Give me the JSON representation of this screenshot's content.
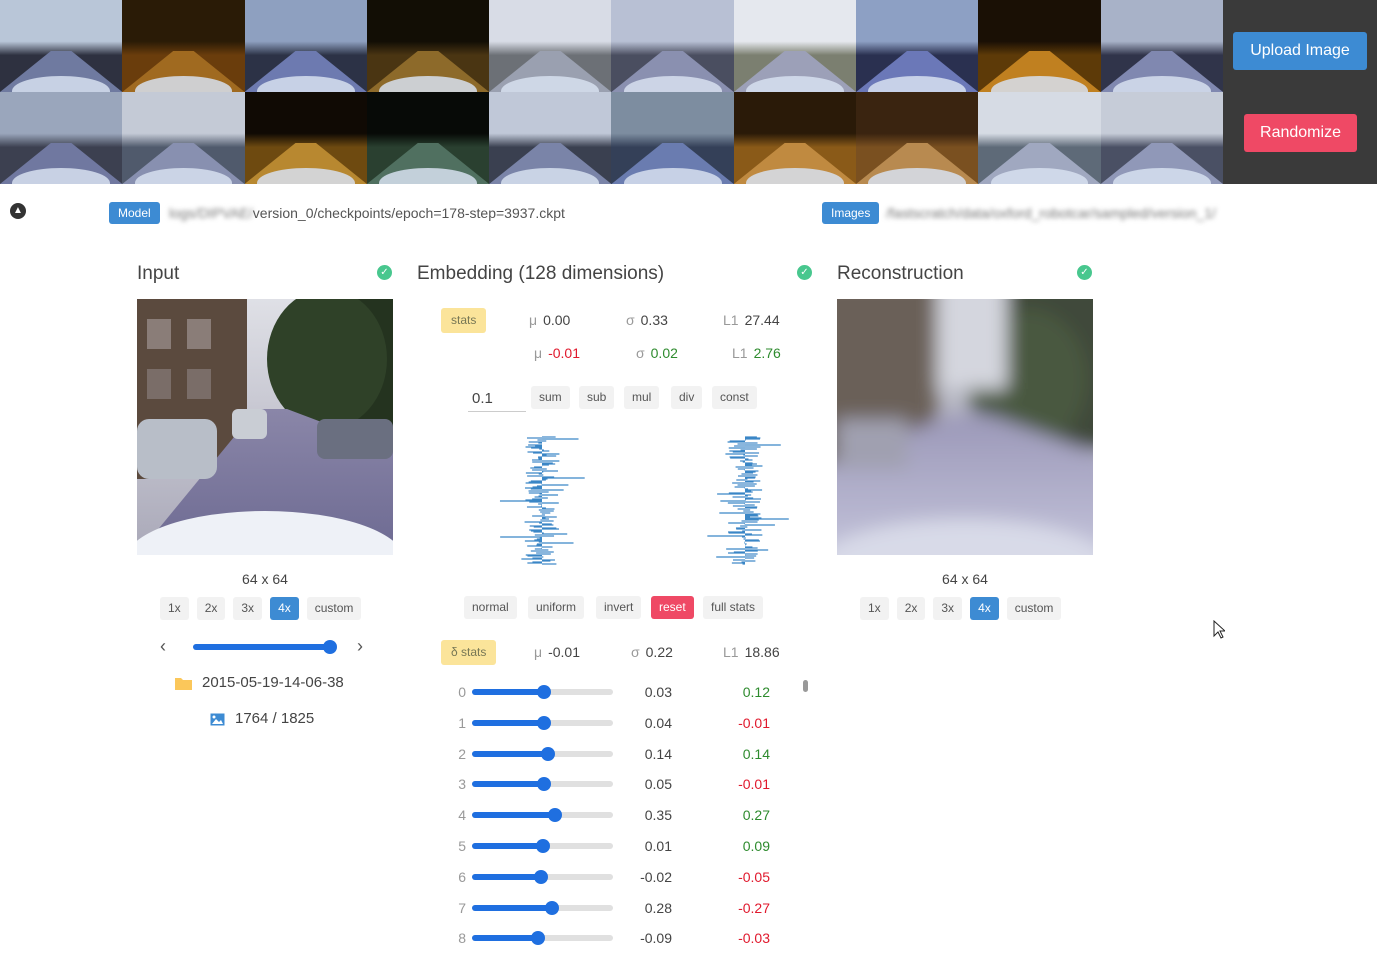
{
  "header": {
    "upload_label": "Upload Image",
    "randomize_label": "Randomize",
    "thumbnails": [
      {
        "sky": "#b9c6d8",
        "ground": "#2e3140",
        "road": "#6f7aa0"
      },
      {
        "sky": "#2a1b06",
        "ground": "#6a3d0c",
        "road": "#a06a20"
      },
      {
        "sky": "#8ea0c0",
        "ground": "#2c3246",
        "road": "#6d7ab0"
      },
      {
        "sky": "#120e05",
        "ground": "#4a3512",
        "road": "#8d6a2a"
      },
      {
        "sky": "#d8dce6",
        "ground": "#6c7076",
        "road": "#9aa0b0"
      },
      {
        "sky": "#b8c0d4",
        "ground": "#4a4e60",
        "road": "#8a90b0"
      },
      {
        "sky": "#e5e8ee",
        "ground": "#7b7f70",
        "road": "#9ca0b8"
      },
      {
        "sky": "#8da0c4",
        "ground": "#2a3050",
        "road": "#6b78b8"
      },
      {
        "sky": "#1a1005",
        "ground": "#5d3a08",
        "road": "#c08020"
      },
      {
        "sky": "#a8b2c8",
        "ground": "#30344a",
        "road": "#8088b0"
      },
      {
        "sky": "#9aa6bc",
        "ground": "#3c4050",
        "road": "#7078a0"
      },
      {
        "sky": "#c4cad6",
        "ground": "#505a6c",
        "road": "#8890b0"
      },
      {
        "sky": "#100a04",
        "ground": "#6e4a10",
        "road": "#b88830"
      },
      {
        "sky": "#070a07",
        "ground": "#2a4030",
        "road": "#507060"
      },
      {
        "sky": "#c0c8d8",
        "ground": "#3a4050",
        "road": "#7a84a8"
      },
      {
        "sky": "#7d8da0",
        "ground": "#344058",
        "road": "#6a7cb0"
      },
      {
        "sky": "#2a1a08",
        "ground": "#8a5a18",
        "road": "#c08a40"
      },
      {
        "sky": "#3a2410",
        "ground": "#7a5020",
        "road": "#b88a50"
      },
      {
        "sky": "#d6dbe4",
        "ground": "#5e6a78",
        "road": "#a0a8c0"
      },
      {
        "sky": "#c6ccd8",
        "ground": "#4a5064",
        "road": "#9098b8"
      }
    ]
  },
  "toolbar": {
    "model_tag": "Model",
    "model_path": "logs/DIPVAE/version_0/checkpoints/epoch=178-step=3937.ckpt",
    "model_path_blurred": "logs/DIPVAE/",
    "model_path_visible": "version_0/checkpoints/epoch=178-step=3937.ckpt",
    "images_tag": "Images",
    "images_path": "/fastscratch/data/oxford_robotcar/sampled/version_1/"
  },
  "input": {
    "title": "Input",
    "size_label": "64 x 64",
    "zoom_options": [
      "1x",
      "2x",
      "3x",
      "4x",
      "custom"
    ],
    "zoom_selected": "4x",
    "frame_position": 0.966,
    "folder": "2015-05-19-14-06-38",
    "frame_counter": "1764 / 1825"
  },
  "embedding": {
    "title": "Embedding (128 dimensions)",
    "stats_label": "stats",
    "stats": {
      "mu": "0.00",
      "sigma": "0.33",
      "l1": "27.44"
    },
    "stats_delta": {
      "mu": "-0.01",
      "sigma": "0.02",
      "l1": "2.76"
    },
    "sym_mu": "μ",
    "sym_sigma": "σ",
    "sym_l1": "L1",
    "op_value": "0.1",
    "ops": [
      "sum",
      "sub",
      "mul",
      "div",
      "const"
    ],
    "dist_buttons": [
      "normal",
      "uniform",
      "invert",
      "reset",
      "full stats"
    ],
    "dstats_label": "δ stats",
    "dstats": {
      "mu": "-0.01",
      "sigma": "0.22",
      "l1": "18.86"
    },
    "dims": [
      {
        "index": "0",
        "value": "0.03",
        "delta": "0.12",
        "level": 0.51,
        "delta_color": "green"
      },
      {
        "index": "1",
        "value": "0.04",
        "delta": "-0.01",
        "level": 0.51,
        "delta_color": "red"
      },
      {
        "index": "2",
        "value": "0.14",
        "delta": "0.14",
        "level": 0.54,
        "delta_color": "green"
      },
      {
        "index": "3",
        "value": "0.05",
        "delta": "-0.01",
        "level": 0.51,
        "delta_color": "red"
      },
      {
        "index": "4",
        "value": "0.35",
        "delta": "0.27",
        "level": 0.59,
        "delta_color": "green"
      },
      {
        "index": "5",
        "value": "0.01",
        "delta": "0.09",
        "level": 0.5,
        "delta_color": "green"
      },
      {
        "index": "6",
        "value": "-0.02",
        "delta": "-0.05",
        "level": 0.49,
        "delta_color": "red"
      },
      {
        "index": "7",
        "value": "0.28",
        "delta": "-0.27",
        "level": 0.57,
        "delta_color": "red"
      },
      {
        "index": "8",
        "value": "-0.09",
        "delta": "-0.03",
        "level": 0.47,
        "delta_color": "red"
      }
    ]
  },
  "reconstruction": {
    "title": "Reconstruction",
    "size_label": "64 x 64",
    "zoom_options": [
      "1x",
      "2x",
      "3x",
      "4x",
      "custom"
    ],
    "zoom_selected": "4x"
  },
  "colors": {
    "accent": "#3d8bd3",
    "danger": "#ef4965",
    "success": "#48c78e",
    "slider": "#1f6fe0",
    "stats_pill": "#fbe49a",
    "positive": "#2e8b2e",
    "negative": "#e0192d"
  }
}
